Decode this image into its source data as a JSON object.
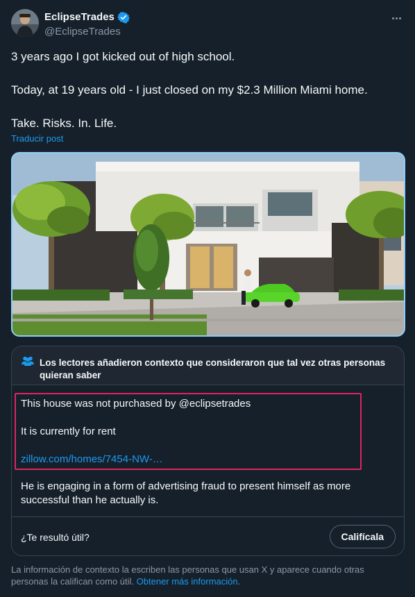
{
  "author": {
    "display_name": "EclipseTrades",
    "handle": "@EclipseTrades",
    "verified_icon": "verified-badge-icon",
    "verified_color": "#1d9bf0"
  },
  "more_icon": "more-horizontal-icon",
  "tweet": {
    "line1": "3 years ago I got kicked out of high school.",
    "line2": "Today, at 19 years old - I just closed on my $2.3 Million Miami home.",
    "line3": "Take. Risks. In. Life.",
    "translate_label": "Traducir post"
  },
  "community_note": {
    "icon": "people-icon",
    "title": "Los lectores añadieron contexto que consideraron que tal vez otras personas quieran saber",
    "line1": "This house was not purchased by @eclipsetrades",
    "line2": "It is currently for rent",
    "link": "zillow.com/homes/7454-NW-…",
    "paragraph": "He is engaging in a form of advertising fraud to present himself as more successful than he actually is.",
    "helpful_question": "¿Te resultó útil?",
    "rate_button": "Califícala"
  },
  "disclaimer": {
    "text": "La información de contexto la escriben las personas que usan X y aparece cuando otras personas la califican como útil.",
    "link": "Obtener más información",
    "trailing": "."
  },
  "colors": {
    "background": "#15202b",
    "note_header": "#1e2732",
    "accent": "#1d9bf0",
    "highlight_box": "#e0245e",
    "media_border": "#8ecdf8"
  }
}
